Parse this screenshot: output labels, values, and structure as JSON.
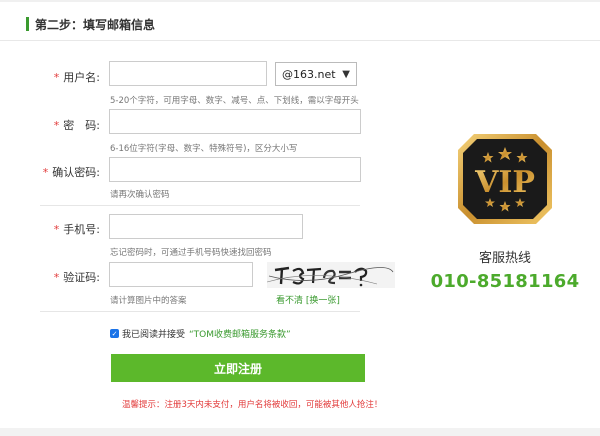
{
  "step": {
    "title": "第二步：填写邮箱信息"
  },
  "form": {
    "username": {
      "label": "用户名:",
      "value": "",
      "hint": "5-20个字符，可用字母、数字、减号、点、下划线，需以字母开头"
    },
    "domain_select": {
      "selected": "@163.net"
    },
    "password": {
      "label": "密　码:",
      "value": "",
      "hint": "6-16位字符(字母、数字、特殊符号)，区分大小写"
    },
    "confirm": {
      "label": "确认密码:",
      "value": "",
      "hint": "请再次确认密码"
    },
    "phone": {
      "label": "手机号:",
      "value": "",
      "hint": "忘记密码时，可通过手机号码快速找回密码"
    },
    "captcha": {
      "label": "验证码:",
      "value": "",
      "hint": "请计算图片中的答案",
      "cant_see": "看不清",
      "refresh": "[换一张]"
    },
    "agree": {
      "text": "我已阅读并接受",
      "terms": "“TOM收费邮箱服务条款”"
    },
    "submit": "立即注册",
    "warning": "温馨提示：注册3天内未支付，用户名将被收回，可能被其他人抢注！"
  },
  "side": {
    "badge_text": "VIP",
    "hotline_label": "客服热线",
    "hotline": "010-85181164"
  },
  "colors": {
    "accent": "#5cb82b",
    "required": "#e23a3a",
    "gold": "#d9a441"
  }
}
